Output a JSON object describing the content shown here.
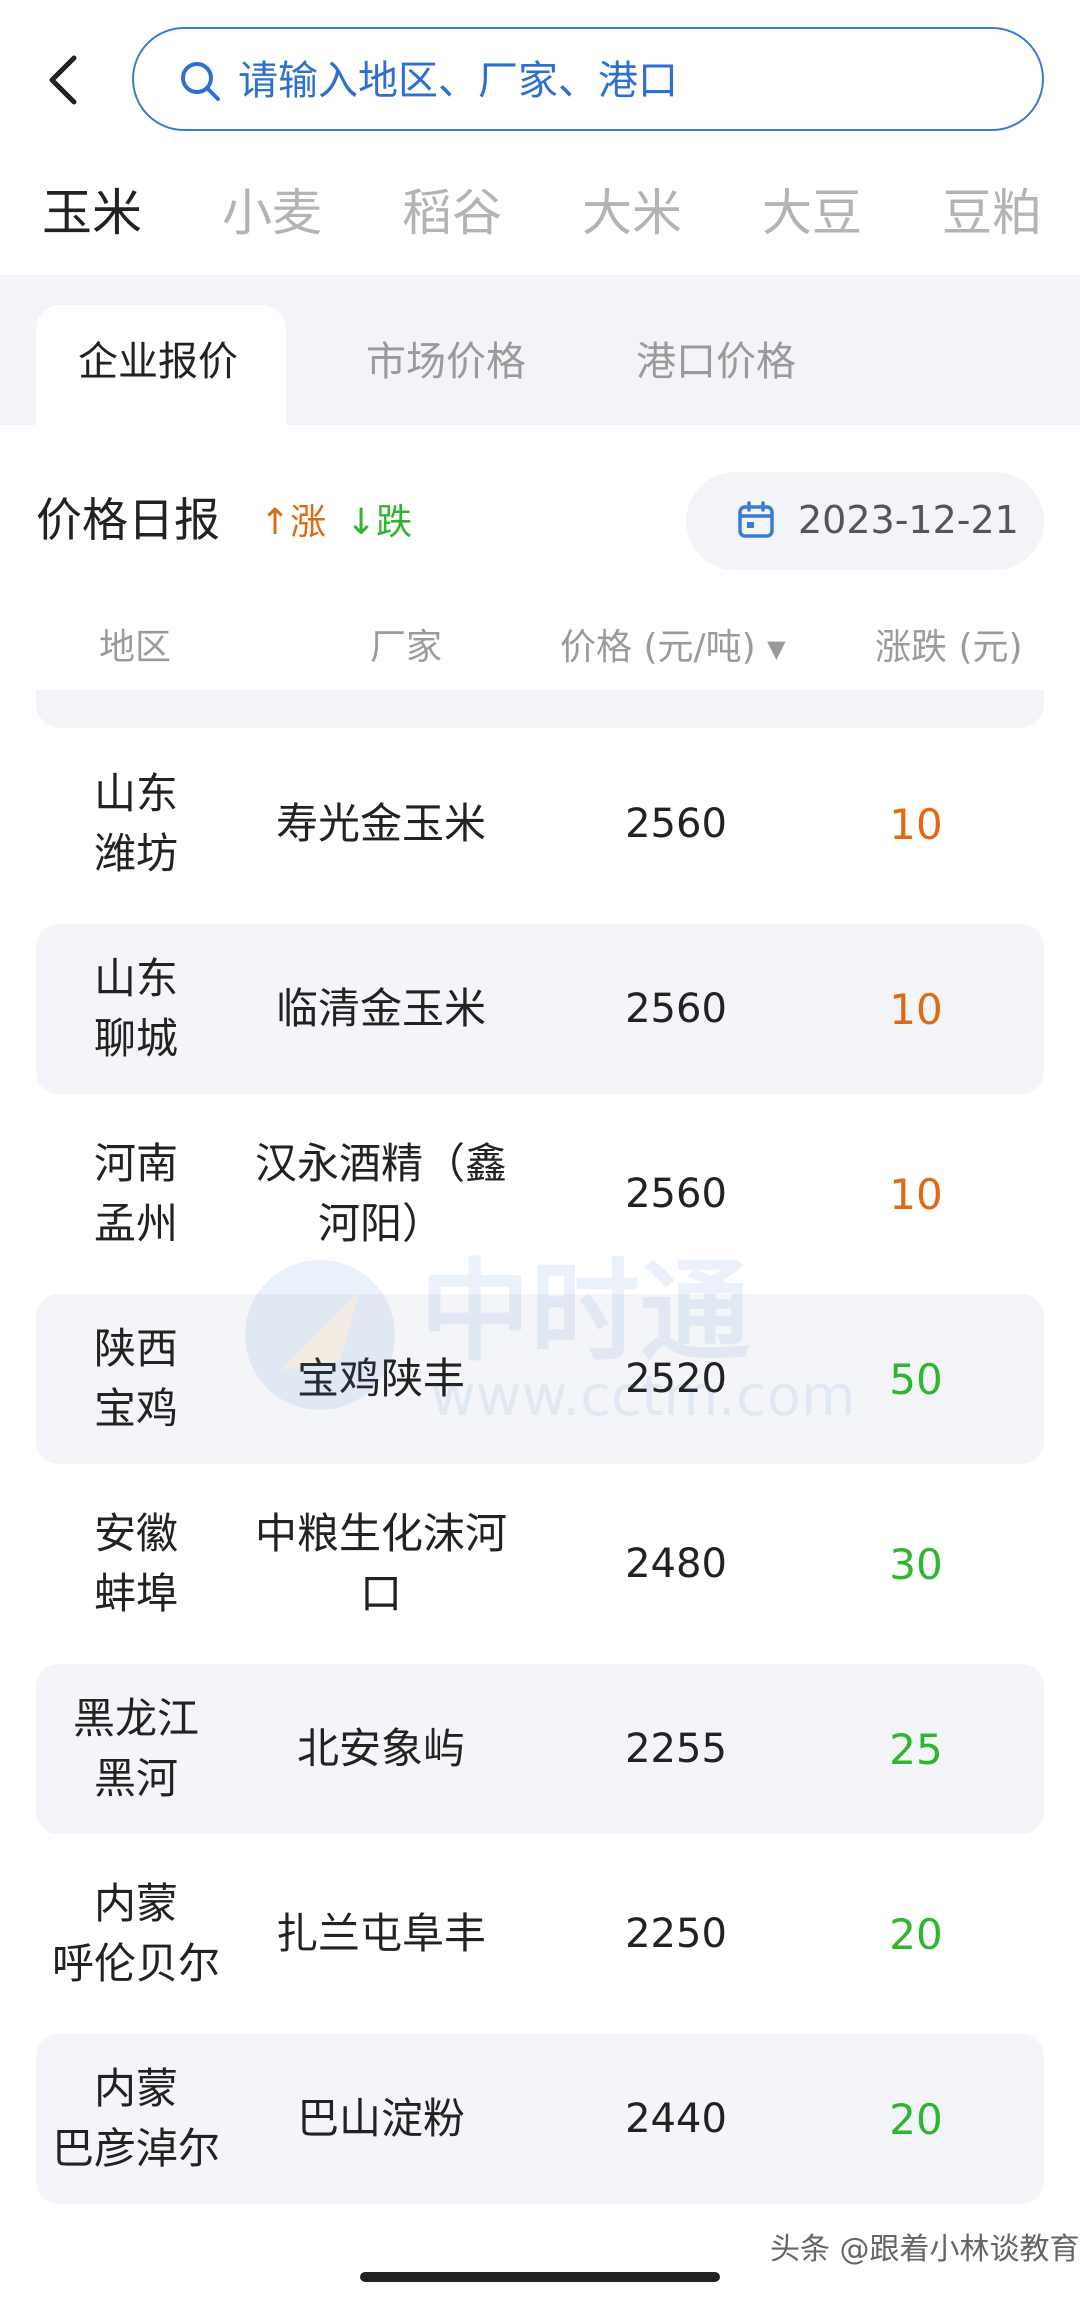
{
  "search": {
    "placeholder": "请输入地区、厂家、港口"
  },
  "categories": [
    "玉米",
    "小麦",
    "稻谷",
    "大米",
    "大豆",
    "豆粕"
  ],
  "sub_tabs": [
    "企业报价",
    "市场价格",
    "港口价格"
  ],
  "report": {
    "title": "价格日报",
    "legend_up": "↑涨",
    "legend_down": "↓跌",
    "date": "2023-12-21"
  },
  "table": {
    "headers": {
      "region": "地区",
      "manufacturer": "厂家",
      "price": "价格 (元/吨)",
      "change": "涨跌 (元)"
    },
    "rows": [
      {
        "region": "山东\n潍坊",
        "manufacturer": "寿光金玉米",
        "price": "2560",
        "change": "10",
        "direction": "up"
      },
      {
        "region": "山东\n聊城",
        "manufacturer": "临清金玉米",
        "price": "2560",
        "change": "10",
        "direction": "up"
      },
      {
        "region": "河南\n孟州",
        "manufacturer": "汉永酒精（鑫\n河阳）",
        "price": "2560",
        "change": "10",
        "direction": "up"
      },
      {
        "region": "陕西\n宝鸡",
        "manufacturer": "宝鸡陕丰",
        "price": "2520",
        "change": "50",
        "direction": "down"
      },
      {
        "region": "安徽\n蚌埠",
        "manufacturer": "中粮生化沫河\n口",
        "price": "2480",
        "change": "30",
        "direction": "down"
      },
      {
        "region": "黑龙江\n黑河",
        "manufacturer": "北安象屿",
        "price": "2255",
        "change": "25",
        "direction": "down"
      },
      {
        "region": "内蒙\n呼伦贝尔",
        "manufacturer": "扎兰屯阜丰",
        "price": "2250",
        "change": "20",
        "direction": "down"
      },
      {
        "region": "内蒙\n巴彦淖尔",
        "manufacturer": "巴山淀粉",
        "price": "2440",
        "change": "20",
        "direction": "down"
      }
    ]
  },
  "watermark": {
    "text": "中时通",
    "url": "www.cctm.com"
  },
  "attribution": "头条 @跟着小林谈教育",
  "colors": {
    "accent": "#3a7bd5",
    "up": "#e06a12",
    "down": "#2fb52f"
  }
}
